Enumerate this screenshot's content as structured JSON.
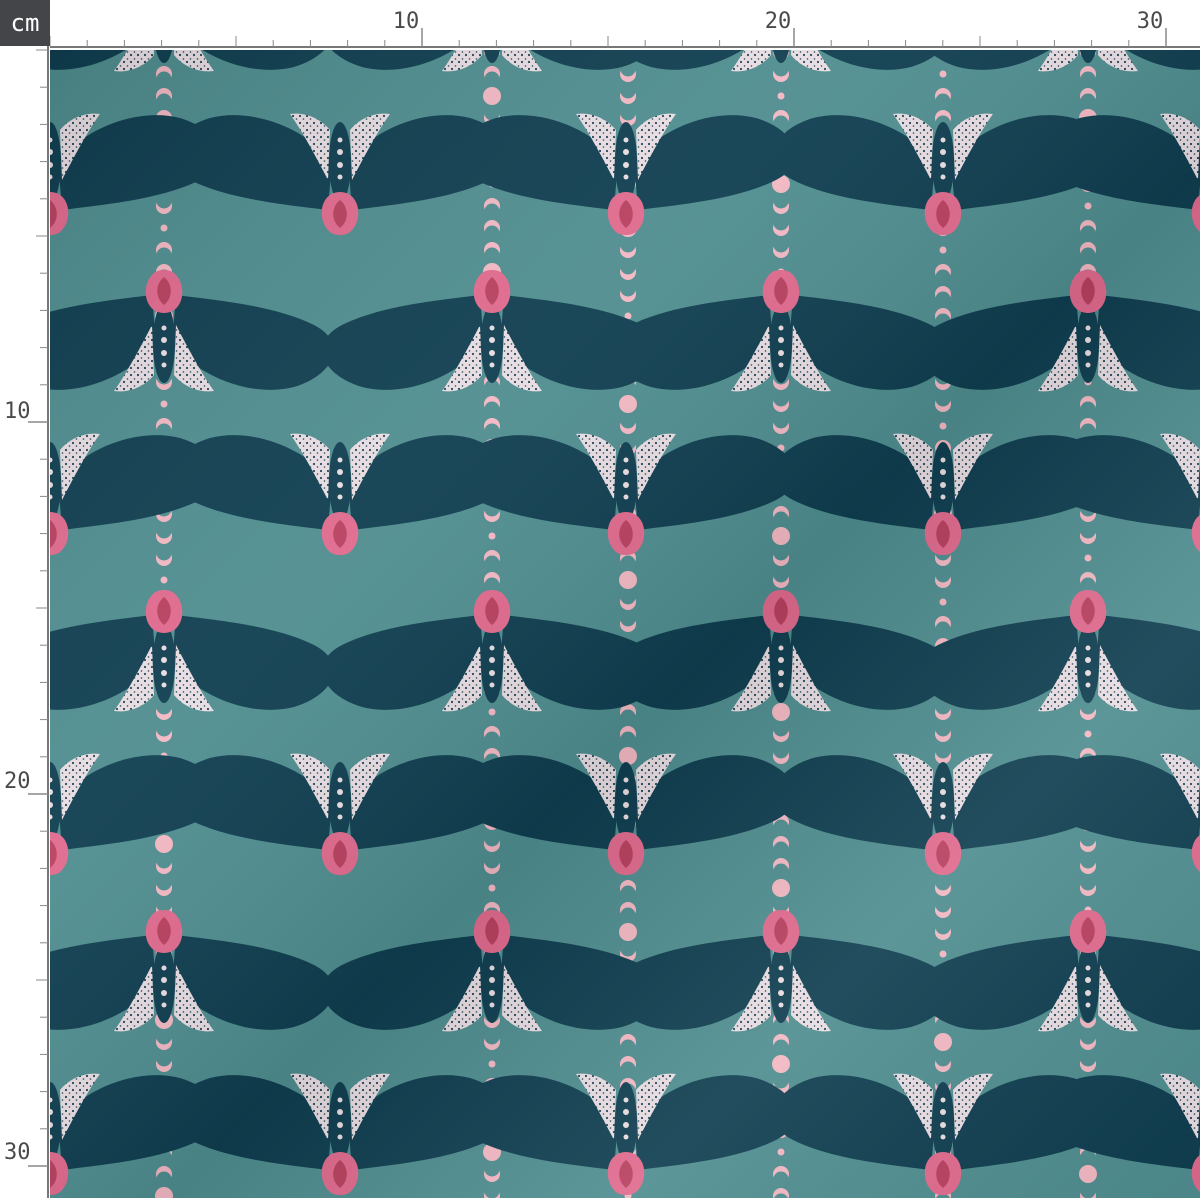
{
  "ruler": {
    "unit": "cm",
    "top_labels": [
      "10",
      "20",
      "30"
    ],
    "left_labels": [
      "10",
      "20",
      "30"
    ]
  },
  "pattern": {
    "background_color": "#4f8d8f",
    "moth_wing_color": "#0f3e50",
    "moth_body_color": "#e06a8e",
    "moth_lace_color": "#e8dde2",
    "moon_color": "#f2b8c3"
  }
}
